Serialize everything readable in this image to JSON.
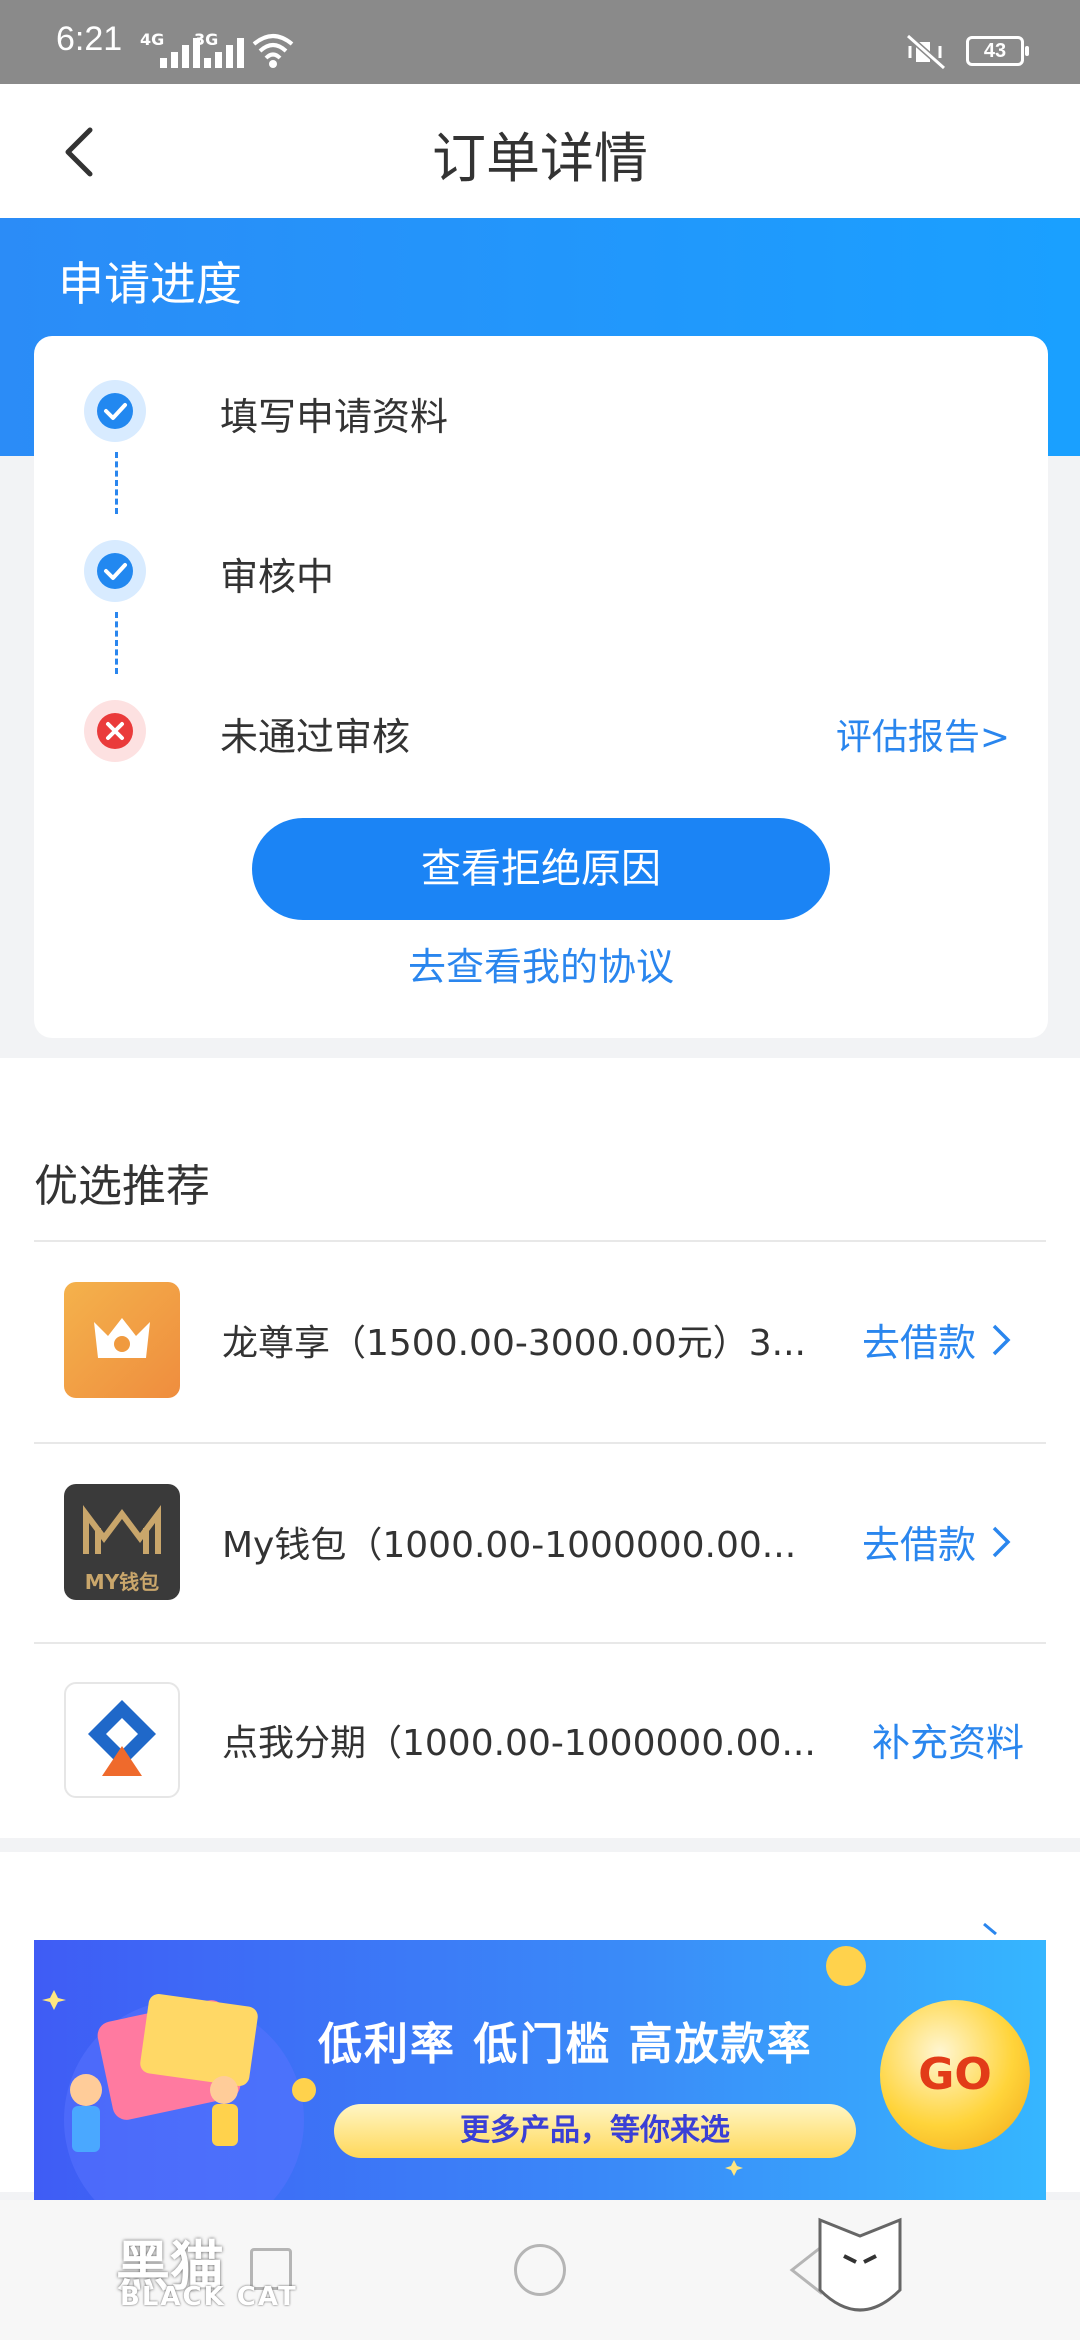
{
  "status_bar": {
    "time": "6:21",
    "net1": "4G",
    "net2": "3G",
    "battery": "43"
  },
  "nav": {
    "title": "订单详情"
  },
  "progress": {
    "title": "申请进度",
    "steps": [
      {
        "label": "填写申请资料",
        "status": "done"
      },
      {
        "label": "审核中",
        "status": "done"
      },
      {
        "label": "未通过审核",
        "status": "failed",
        "link": "评估报告>"
      }
    ],
    "primary_button": "查看拒绝原因",
    "protocol_link": "去查看我的协议"
  },
  "recommend": {
    "title": "优选推荐",
    "items": [
      {
        "name": "龙尊享（1500.00-3000.00元）3...",
        "action": "去借款",
        "logo": "crown-logo"
      },
      {
        "name": "My钱包（1000.00-1000000.00...",
        "action": "去借款",
        "logo": "my-wallet-logo",
        "logo_text": "MY钱包"
      },
      {
        "name": "点我分期（1000.00-1000000.00...",
        "action": "补充资料",
        "logo": "diamond-logo"
      }
    ]
  },
  "banner": {
    "headline": "低利率 低门槛 高放款率",
    "pill": "更多产品，等你来选",
    "go": "GO"
  },
  "watermark": {
    "cn": "黑猫",
    "en": "BLACK CAT"
  },
  "colors": {
    "accent": "#1b84f5",
    "fail": "#ea3b3b",
    "header": "#2b8cf7"
  }
}
